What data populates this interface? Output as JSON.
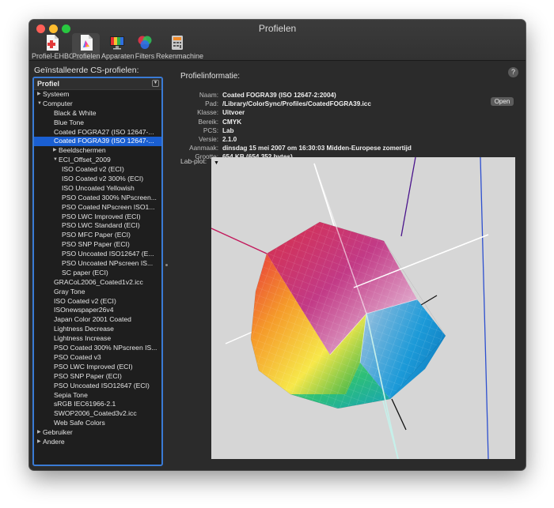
{
  "window": {
    "title": "Profielen"
  },
  "toolbar": {
    "items": [
      {
        "label": "Profiel-EHBO",
        "icon": "first-aid-icon"
      },
      {
        "label": "Profielen",
        "icon": "profile-icon"
      },
      {
        "label": "Apparaten",
        "icon": "display-icon"
      },
      {
        "label": "Filters",
        "icon": "filters-icon"
      },
      {
        "label": "Rekenmachine",
        "icon": "calculator-icon"
      }
    ]
  },
  "sidebar": {
    "title": "Geïnstalleerde CS-profielen:",
    "column_header": "Profiel",
    "items": [
      {
        "label": "Systeem",
        "level": 0,
        "disclosure": "collapsed"
      },
      {
        "label": "Computer",
        "level": 0,
        "disclosure": "expanded"
      },
      {
        "label": "Black & White",
        "level": 1
      },
      {
        "label": "Blue Tone",
        "level": 1
      },
      {
        "label": "Coated FOGRA27 (ISO 12647-...",
        "level": 1
      },
      {
        "label": "Coated FOGRA39 (ISO 12647-...",
        "level": 1,
        "selected": true
      },
      {
        "label": "Beeldschermen",
        "level": 1,
        "disclosure": "collapsed"
      },
      {
        "label": "ECI_Offset_2009",
        "level": 1,
        "disclosure": "expanded"
      },
      {
        "label": "ISO Coated v2 (ECI)",
        "level": 2
      },
      {
        "label": "ISO Coated v2 300% (ECI)",
        "level": 2
      },
      {
        "label": "ISO Uncoated Yellowish",
        "level": 2
      },
      {
        "label": "PSO Coated 300% NPscreen...",
        "level": 2
      },
      {
        "label": "PSO Coated NPscreen ISO1...",
        "level": 2
      },
      {
        "label": "PSO LWC Improved (ECI)",
        "level": 2
      },
      {
        "label": "PSO LWC Standard (ECI)",
        "level": 2
      },
      {
        "label": "PSO MFC Paper (ECI)",
        "level": 2
      },
      {
        "label": "PSO SNP Paper (ECI)",
        "level": 2
      },
      {
        "label": "PSO Uncoated ISO12647 (E...",
        "level": 2
      },
      {
        "label": "PSO Uncoated NPscreen IS...",
        "level": 2
      },
      {
        "label": "SC paper (ECI)",
        "level": 2
      },
      {
        "label": "GRACoL2006_Coated1v2.icc",
        "level": 1
      },
      {
        "label": "Gray Tone",
        "level": 1
      },
      {
        "label": "ISO Coated v2 (ECI)",
        "level": 1
      },
      {
        "label": "ISOnewspaper26v4",
        "level": 1
      },
      {
        "label": "Japan Color 2001 Coated",
        "level": 1
      },
      {
        "label": "Lightness Decrease",
        "level": 1
      },
      {
        "label": "Lightness Increase",
        "level": 1
      },
      {
        "label": "PSO Coated 300% NPscreen IS...",
        "level": 1
      },
      {
        "label": "PSO Coated v3",
        "level": 1
      },
      {
        "label": "PSO LWC Improved (ECI)",
        "level": 1
      },
      {
        "label": "PSO SNP Paper (ECI)",
        "level": 1
      },
      {
        "label": "PSO Uncoated ISO12647 (ECI)",
        "level": 1
      },
      {
        "label": "Sepia Tone",
        "level": 1
      },
      {
        "label": "sRGB IEC61966-2.1",
        "level": 1
      },
      {
        "label": "SWOP2006_Coated3v2.icc",
        "level": 1
      },
      {
        "label": "Web Safe Colors",
        "level": 1
      },
      {
        "label": "Gebruiker",
        "level": 0,
        "disclosure": "collapsed"
      },
      {
        "label": "Andere",
        "level": 0,
        "disclosure": "collapsed"
      }
    ]
  },
  "info": {
    "title": "Profielinformatie:",
    "help": "?",
    "open_button": "Open",
    "fields": [
      {
        "key": "Naam:",
        "value": "Coated FOGRA39 (ISO 12647-2:2004)"
      },
      {
        "key": "Pad:",
        "value": "/Library/ColorSync/Profiles/CoatedFOGRA39.icc"
      },
      {
        "key": "Klasse:",
        "value": "Uitvoer"
      },
      {
        "key": "Bereik:",
        "value": "CMYK"
      },
      {
        "key": "PCS:",
        "value": "Lab"
      },
      {
        "key": "Versie:",
        "value": "2.1.0"
      },
      {
        "key": "Aanmaak:",
        "value": "dinsdag 15 mei 2007 om 16:30:03 Midden-Europese zomertijd"
      },
      {
        "key": "Grootte:",
        "value": "654 KB (654.352 bytes)"
      }
    ],
    "plot_label": "Lab-plot:"
  }
}
